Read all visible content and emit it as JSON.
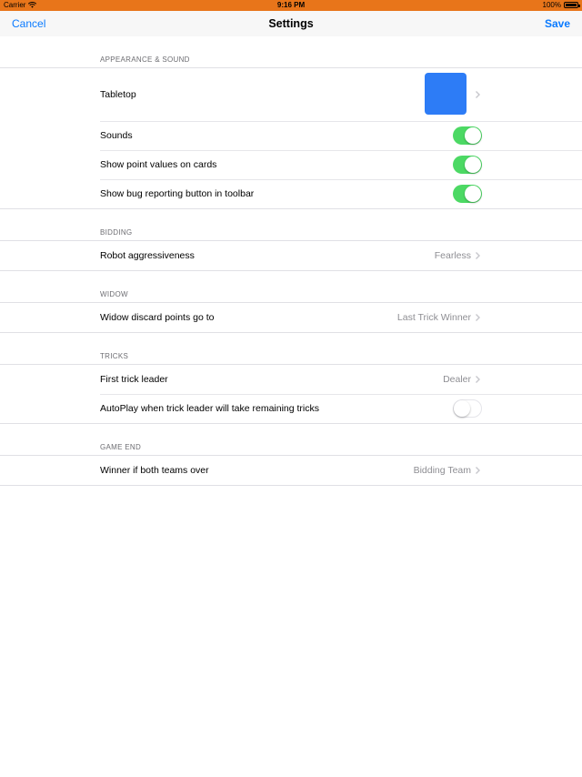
{
  "status_bar": {
    "carrier": "Carrier",
    "time": "9:16 PM",
    "battery": "100%"
  },
  "nav": {
    "cancel": "Cancel",
    "title": "Settings",
    "save": "Save"
  },
  "colors": {
    "accent": "#0a7aff",
    "status_bar": "#e8751a",
    "toggle_on": "#4cd964",
    "tabletop_swatch": "#2d7cf6"
  },
  "sections": {
    "appearance": {
      "header": "APPEARANCE & SOUND",
      "tabletop": "Tabletop",
      "sounds": "Sounds",
      "sounds_on": true,
      "point_values": "Show point values on cards",
      "point_values_on": true,
      "bug_button": "Show bug reporting button in toolbar",
      "bug_button_on": true
    },
    "bidding": {
      "header": "BIDDING",
      "robot": "Robot aggressiveness",
      "robot_value": "Fearless"
    },
    "widow": {
      "header": "WIDOW",
      "discard": "Widow discard points go to",
      "discard_value": "Last Trick Winner"
    },
    "tricks": {
      "header": "TRICKS",
      "leader": "First trick leader",
      "leader_value": "Dealer",
      "autoplay": "AutoPlay when trick leader will take remaining tricks",
      "autoplay_on": false
    },
    "game_end": {
      "header": "GAME END",
      "winner": "Winner if both teams over",
      "winner_value": "Bidding Team"
    }
  }
}
